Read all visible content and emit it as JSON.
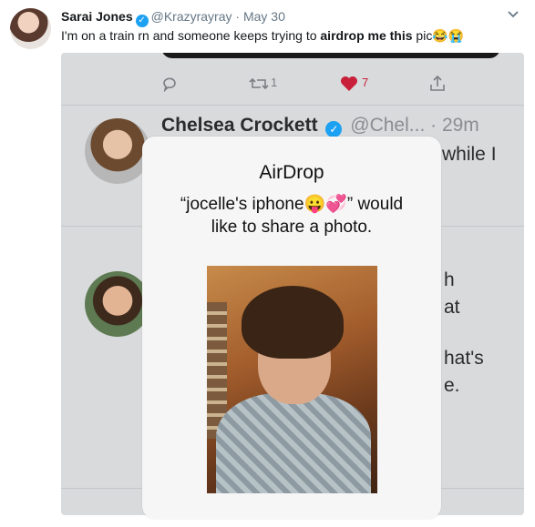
{
  "tweet": {
    "display_name": "Sarai Jones",
    "handle": "@Krazyrayray",
    "separator": "·",
    "date": "May 30",
    "text_before": "I'm on a train rn and someone keeps trying to ",
    "text_bold": "airdrop me this",
    "text_after": " pic😂😭"
  },
  "embedded": {
    "actions": {
      "retweet_count": "1",
      "like_count": "7"
    },
    "reply_tweet": {
      "name": "Chelsea Crockett",
      "handle": "@Chel...",
      "time": "· 29m"
    },
    "fragments": [
      "while I",
      "h",
      "at",
      "hat's",
      "e."
    ]
  },
  "airdrop": {
    "title": "AirDrop",
    "message_line1": "“jocelle's iphone😛💞” would",
    "message_line2": "like to share a photo."
  },
  "colors": {
    "verified": "#1da1f2",
    "like": "#e0245e"
  },
  "icons": [
    "verified-icon",
    "chevron-down-icon",
    "reply-icon",
    "retweet-icon",
    "heart-icon",
    "share-icon"
  ]
}
